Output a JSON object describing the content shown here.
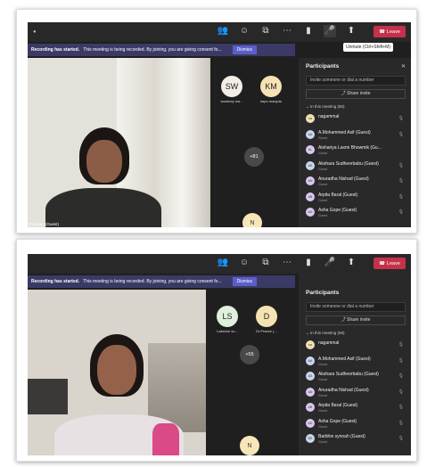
{
  "colors": {
    "leave": "#c4314b",
    "banner": "#3b3a66",
    "dismiss": "#5b5fc7",
    "panel": "#2a2929"
  },
  "top": {
    "toolbar": {
      "tooltip": "Unmute (Ctrl+Shift+M)",
      "leave": "Leave"
    },
    "banner": {
      "title": "Recording has started.",
      "text": "This meeting is being recorded. By joining, you are giving consent fo...",
      "dismiss": "Dismiss"
    },
    "video": {
      "name": "Praveen (Guest)"
    },
    "gallery": [
      {
        "initials": "SW",
        "name": "sandeep wa...",
        "color": "#f3efe6"
      },
      {
        "initials": "KM",
        "name": "kapu manjula",
        "color": "#f5e3b4"
      }
    ],
    "more": "+81",
    "gallery_bottom": "N",
    "panel": {
      "title": "Participants",
      "invite_placeholder": "Invite someone or dial a number",
      "share": "Share invite",
      "section": "In this meeting (85)",
      "people": [
        {
          "initials": "na",
          "name": "nagammal",
          "sub": "",
          "color": "#f2dfb0"
        },
        {
          "initials": "AA",
          "name": "A.Mohammed Asif (Guest)",
          "sub": "Guest",
          "color": "#c8d6f0"
        },
        {
          "initials": "AL",
          "name": "Aishariya Laxmi Bhowmik (Gu...",
          "sub": "Guest",
          "color": "#d9c9ef"
        },
        {
          "initials": "AS",
          "name": "Akshara Sudheerbabu (Guest)",
          "sub": "Guest",
          "color": "#c8d6f0"
        },
        {
          "initials": "AN",
          "name": "Anuradha Nishad (Guest)",
          "sub": "Guest",
          "color": "#d9c9ef"
        },
        {
          "initials": "AB",
          "name": "Arpita Baral (Guest)",
          "sub": "Guest",
          "color": "#d9c9ef"
        },
        {
          "initials": "AG",
          "name": "Asha Gope (Guest)",
          "sub": "Guest",
          "color": "#d9c9ef"
        }
      ]
    }
  },
  "bottom": {
    "toolbar": {
      "leave": "Leave"
    },
    "banner": {
      "title": "Recording has started.",
      "text": "This meeting is being recorded. By joining, you are giving consent fo...",
      "dismiss": "Dismiss"
    },
    "gallery": [
      {
        "initials": "LS",
        "name": "Lakshmi su...",
        "color": "#dff0dc"
      },
      {
        "initials": "D",
        "name": "Dr.Pravee (...",
        "color": "#f5e3b4"
      }
    ],
    "more": "+55",
    "gallery_bottom": "N",
    "panel": {
      "title": "Participants",
      "invite_placeholder": "Invite someone or dial a number",
      "share": "Share invite",
      "section": "In this meeting (59)",
      "people": [
        {
          "initials": "na",
          "name": "nagammal",
          "sub": "",
          "color": "#f2dfb0"
        },
        {
          "initials": "AA",
          "name": "A.Mohammed Asif (Guest)",
          "sub": "Guest",
          "color": "#c8d6f0"
        },
        {
          "initials": "AS",
          "name": "Akshara Sudheerbabu (Guest)",
          "sub": "Guest",
          "color": "#c8d6f0"
        },
        {
          "initials": "AN",
          "name": "Anuradha Nishad (Guest)",
          "sub": "Guest",
          "color": "#d9c9ef"
        },
        {
          "initials": "AB",
          "name": "Arpita Baral (Guest)",
          "sub": "Guest",
          "color": "#d9c9ef"
        },
        {
          "initials": "AG",
          "name": "Asha Gope (Guest)",
          "sub": "Guest",
          "color": "#d9c9ef"
        },
        {
          "initials": "BS",
          "name": "Barbhie synnah (Guest)",
          "sub": "Guest",
          "color": "#c8d6f0"
        }
      ]
    }
  }
}
